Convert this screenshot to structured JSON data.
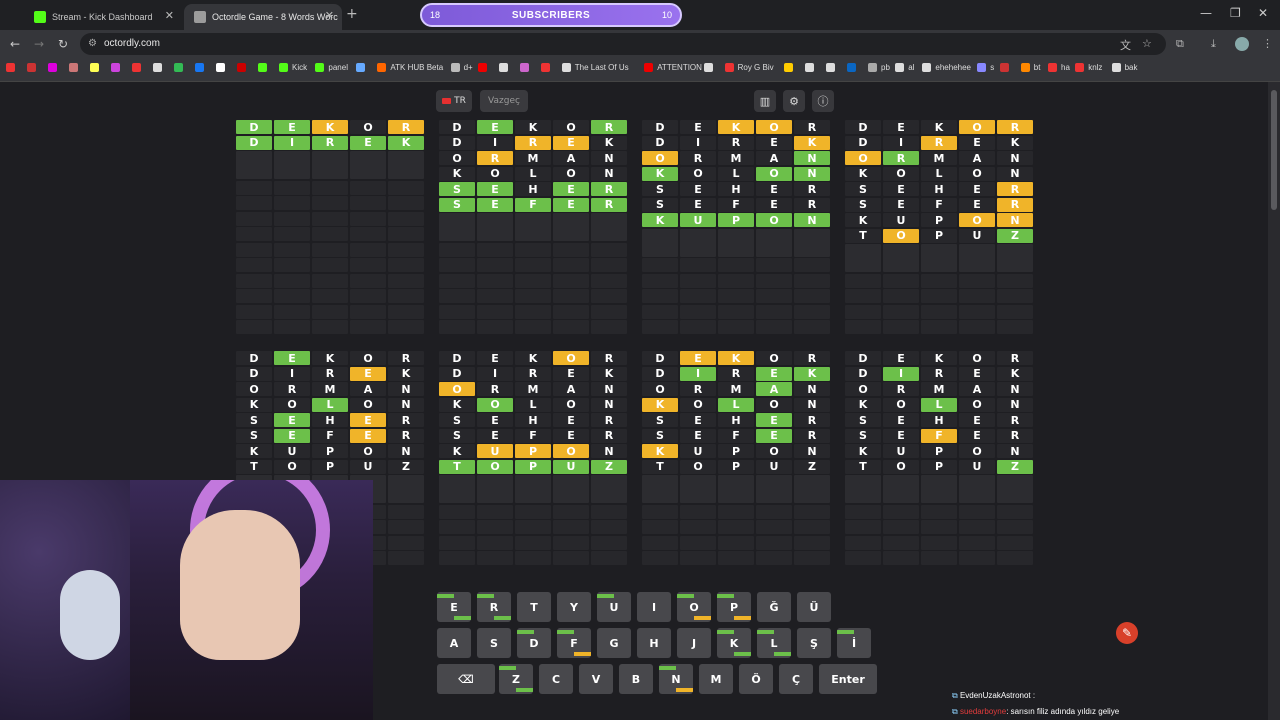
{
  "browser": {
    "tabs": [
      {
        "title": "Stream - Kick Dashboard",
        "color": "#53fc18"
      },
      {
        "title": "Octordle Game - 8 Words Worc",
        "color": "#9c9c9c"
      }
    ],
    "url": "octordly.com",
    "bookmarks": [
      "",
      "",
      "",
      "",
      "",
      "",
      "",
      "",
      "",
      "",
      "",
      "",
      "",
      "Kick",
      "panel",
      "",
      "ATK HUB Beta",
      "d+",
      "",
      "",
      "",
      "",
      "The Last Of Us",
      "ATTENTION",
      "",
      "Roy G Biv",
      "",
      "",
      "",
      "",
      "pb",
      "al",
      "ehehehee",
      "s",
      "",
      "bt",
      "ha",
      "knlz",
      "bak"
    ]
  },
  "subscribers": {
    "label": "SUBSCRIBERS",
    "current": "18",
    "goal": "10"
  },
  "toolbar": {
    "lang": "TR",
    "giveup": "Vazgeç"
  },
  "boards": [
    {
      "rows": [
        {
          "w": "DEKOR",
          "c": "ggyby"
        },
        {
          "w": "DIREK",
          "c": "gggg g"
        }
      ]
    },
    {
      "rows": [
        {
          "w": "DEKOR",
          "c": "bgbbg"
        },
        {
          "w": "DIREK",
          "c": "bbyyb"
        },
        {
          "w": "ORMAN",
          "c": "bybbb"
        },
        {
          "w": "KOLON",
          "c": "bbbbb"
        },
        {
          "w": "SEHER",
          "c": "ggbgg"
        },
        {
          "w": "SEFER",
          "c": "ggggg"
        }
      ]
    },
    {
      "rows": [
        {
          "w": "DEKOR",
          "c": "bbyyb"
        },
        {
          "w": "DIREK",
          "c": "bbbby"
        },
        {
          "w": "ORMAN",
          "c": "ybbbg"
        },
        {
          "w": "KOLON",
          "c": "gbbgg"
        },
        {
          "w": "SEHER",
          "c": "bbbbb"
        },
        {
          "w": "SEFER",
          "c": "bbbbb"
        },
        {
          "w": "KUPON",
          "c": "ggggg"
        }
      ]
    },
    {
      "rows": [
        {
          "w": "DEKOR",
          "c": "bbbyy"
        },
        {
          "w": "DIREK",
          "c": "bbybb"
        },
        {
          "w": "ORMAN",
          "c": "ygbbb"
        },
        {
          "w": "KOLON",
          "c": "bbbbb"
        },
        {
          "w": "SEHER",
          "c": "bbbby"
        },
        {
          "w": "SEFER",
          "c": "bbbby"
        },
        {
          "w": "KUPON",
          "c": "bbbyy"
        },
        {
          "w": "TOPUZ",
          "c": "bybbg"
        }
      ]
    },
    {
      "rows": [
        {
          "w": "DEKOR",
          "c": "bgbbb"
        },
        {
          "w": "DIREK",
          "c": "bbbyb"
        },
        {
          "w": "ORMAN",
          "c": "bbbbb"
        },
        {
          "w": "KOLON",
          "c": "bbgbb"
        },
        {
          "w": "SEHER",
          "c": "bgbyb"
        },
        {
          "w": "SEFER",
          "c": "bgbyb"
        },
        {
          "w": "KUPON",
          "c": "bbbbb"
        },
        {
          "w": "TOPUZ",
          "c": "bbbbb"
        }
      ]
    },
    {
      "rows": [
        {
          "w": "DEKOR",
          "c": "bbbyb"
        },
        {
          "w": "DIREK",
          "c": "bbbbb"
        },
        {
          "w": "ORMAN",
          "c": "ybbbb"
        },
        {
          "w": "KOLON",
          "c": "bgbbb"
        },
        {
          "w": "SEHER",
          "c": "bbbbb"
        },
        {
          "w": "SEFER",
          "c": "bbbbb"
        },
        {
          "w": "KUPON",
          "c": "byyyb"
        },
        {
          "w": "TOPUZ",
          "c": "ggggg"
        }
      ]
    },
    {
      "rows": [
        {
          "w": "DEKOR",
          "c": "byybb"
        },
        {
          "w": "DIREK",
          "c": "bgbgg"
        },
        {
          "w": "ORMAN",
          "c": "bbbgb"
        },
        {
          "w": "KOLON",
          "c": "ybgbb"
        },
        {
          "w": "SEHER",
          "c": "bbbgb"
        },
        {
          "w": "SEFER",
          "c": "bbbgb"
        },
        {
          "w": "KUPON",
          "c": "ybbbb"
        },
        {
          "w": "TOPUZ",
          "c": "bbbbb"
        }
      ]
    },
    {
      "rows": [
        {
          "w": "DEKOR",
          "c": "bbbbb"
        },
        {
          "w": "DIREK",
          "c": "bgbbb"
        },
        {
          "w": "ORMAN",
          "c": "bbbbb"
        },
        {
          "w": "KOLON",
          "c": "bbgbb"
        },
        {
          "w": "SEHER",
          "c": "bbbbb"
        },
        {
          "w": "SEFER",
          "c": "bbybb"
        },
        {
          "w": "KUPON",
          "c": "bbbbb"
        },
        {
          "w": "TOPUZ",
          "c": "bbbbg"
        }
      ]
    }
  ],
  "keyboard": {
    "row1": [
      "E",
      "R",
      "T",
      "Y",
      "U",
      "I",
      "O",
      "P",
      "Ğ",
      "Ü"
    ],
    "row2": [
      "A",
      "S",
      "D",
      "F",
      "G",
      "H",
      "J",
      "K",
      "L",
      "Ş",
      "İ"
    ],
    "row3": [
      "⌫",
      "Z",
      "C",
      "V",
      "B",
      "N",
      "M",
      "Ö",
      "Ç",
      "Enter"
    ]
  },
  "chat": [
    {
      "user": "EvdenUzakAstronot",
      "text": ":",
      "color": "#ffffff"
    },
    {
      "user": "suedarboyne",
      "text": ": sarısın filiz adında yıldız geliye",
      "color": "#e23c3c"
    }
  ],
  "colors": {
    "green": "#6cc04a",
    "yellow": "#f0b429",
    "accent": "#9a72ee"
  }
}
